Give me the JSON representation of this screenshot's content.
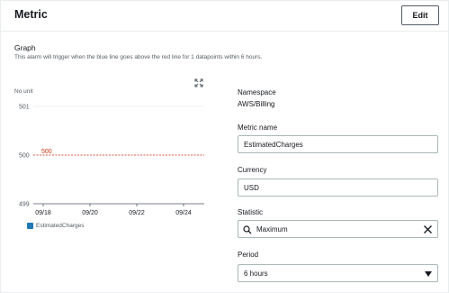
{
  "panel": {
    "title": "Metric",
    "edit_label": "Edit"
  },
  "graph": {
    "title": "Graph",
    "description": "This alarm will trigger when the blue line goes above the red line for 1 datapoints within 6 hours.",
    "unit_label": "No unit",
    "expand_icon": "expand-icon"
  },
  "chart_data": {
    "type": "line",
    "x_ticks": [
      "09/18",
      "09/20",
      "09/22",
      "09/24"
    ],
    "y_ticks": [
      499,
      500,
      501
    ],
    "ylim": [
      499,
      501
    ],
    "ylabel": "No unit",
    "series": [
      {
        "name": "EstimatedCharges",
        "color": "#1f77b4",
        "values": []
      }
    ],
    "threshold": {
      "value": 500,
      "label": "500",
      "color": "#d13212"
    },
    "legend_position": "bottom-left",
    "grid": true
  },
  "details": {
    "namespace_label": "Namespace",
    "namespace_value": "AWS/Billing",
    "metric_name_label": "Metric name",
    "metric_name_value": "EstimatedCharges",
    "currency_label": "Currency",
    "currency_value": "USD",
    "statistic_label": "Statistic",
    "statistic_value": "Maximum",
    "period_label": "Period",
    "period_value": "6 hours"
  },
  "colors": {
    "series": "#1f77b4",
    "threshold": "#d13212",
    "grid": "#e9ebed"
  }
}
